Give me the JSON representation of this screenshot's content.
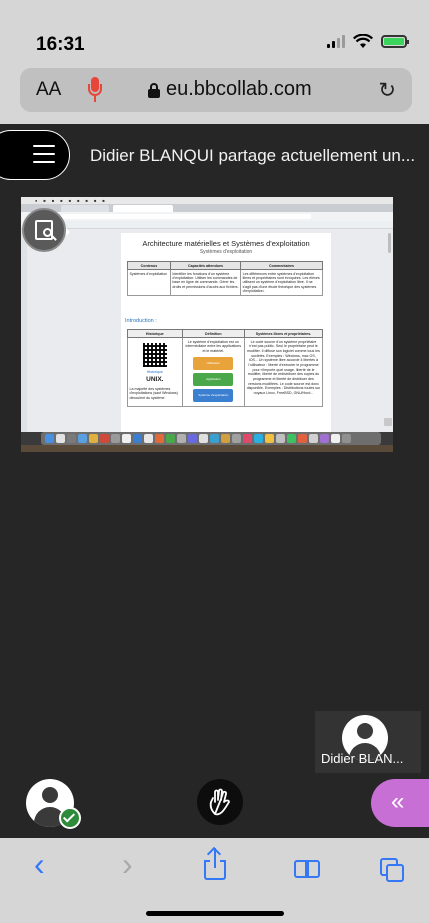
{
  "status_bar": {
    "time": "16:31"
  },
  "safari": {
    "text_size_label": "AA",
    "url": "eu.bbcollab.com"
  },
  "session": {
    "share_title": "Didier BLANQUI partage actuellement un..."
  },
  "shared_document": {
    "title": "Architecture matérielles et Systèmes d'exploitation",
    "subtitle": "Systèmes d'exploitation",
    "table1": {
      "headers": [
        "Contenus",
        "Capacités attendues",
        "Commentaires"
      ],
      "row": [
        "Systèmes d'exploitation",
        "Identifier les fonctions d'un système d'exploitation. Utiliser les commandes de base en ligne de commande. Gérer les droits et permissions d'accès aux fichiers.",
        "Les différences entre systèmes d'exploitation libres et propriétaires sont évoquées. Les élèves utilisent un système d'exploitation libre. Il ne s'agit pas d'une étude théorique des systèmes d'exploitation."
      ]
    },
    "intro_heading": "Introduction :",
    "table2": {
      "headers": [
        "Historique",
        "Définition",
        "Systèmes libres et propriétaires."
      ],
      "history_link": "Historique",
      "unix_label": "UNIX.",
      "history_text": "La majorité des systèmes d'exploitations (sauf Windows) découlent du système",
      "definition_text": "Le système d'exploitation est un intermédiaire entre les applications et le matériel.",
      "puzzle_labels": [
        "Utilisateur",
        "Application",
        "Système d'exploitation"
      ],
      "libre_text": "Le code source d'un système propriétaire n'est pas public. Seul le propriétaire peut le modifier. Il diffuse son logiciel comme tous les sociétés. Exemples : Windows, mac OS, iOS... Un système libre accorde 4 libertés à l'utilisateur : liberté d'exécuter le programme pour n'importe quel usage, liberté de le modifier, liberté de redistribuer des copies du programme et liberté de distribuer des versions modifiées. Le code source est donc disponible. Exemples : Distributions toutes sur noyaux Linux, FreeBSD, GNU/Hurd..."
    }
  },
  "participant": {
    "name": "Didier BLAN..."
  },
  "controls": {
    "raise_hand_icon": "hand-icon",
    "panel_toggle_glyph": "«"
  },
  "toolbar": {
    "back_glyph": "‹",
    "forward_glyph": "›"
  },
  "colors": {
    "accent_purple": "#c86fd6",
    "ios_blue": "#3478f6",
    "status_green": "#2e8b3a",
    "mic_red": "#e8463b"
  }
}
